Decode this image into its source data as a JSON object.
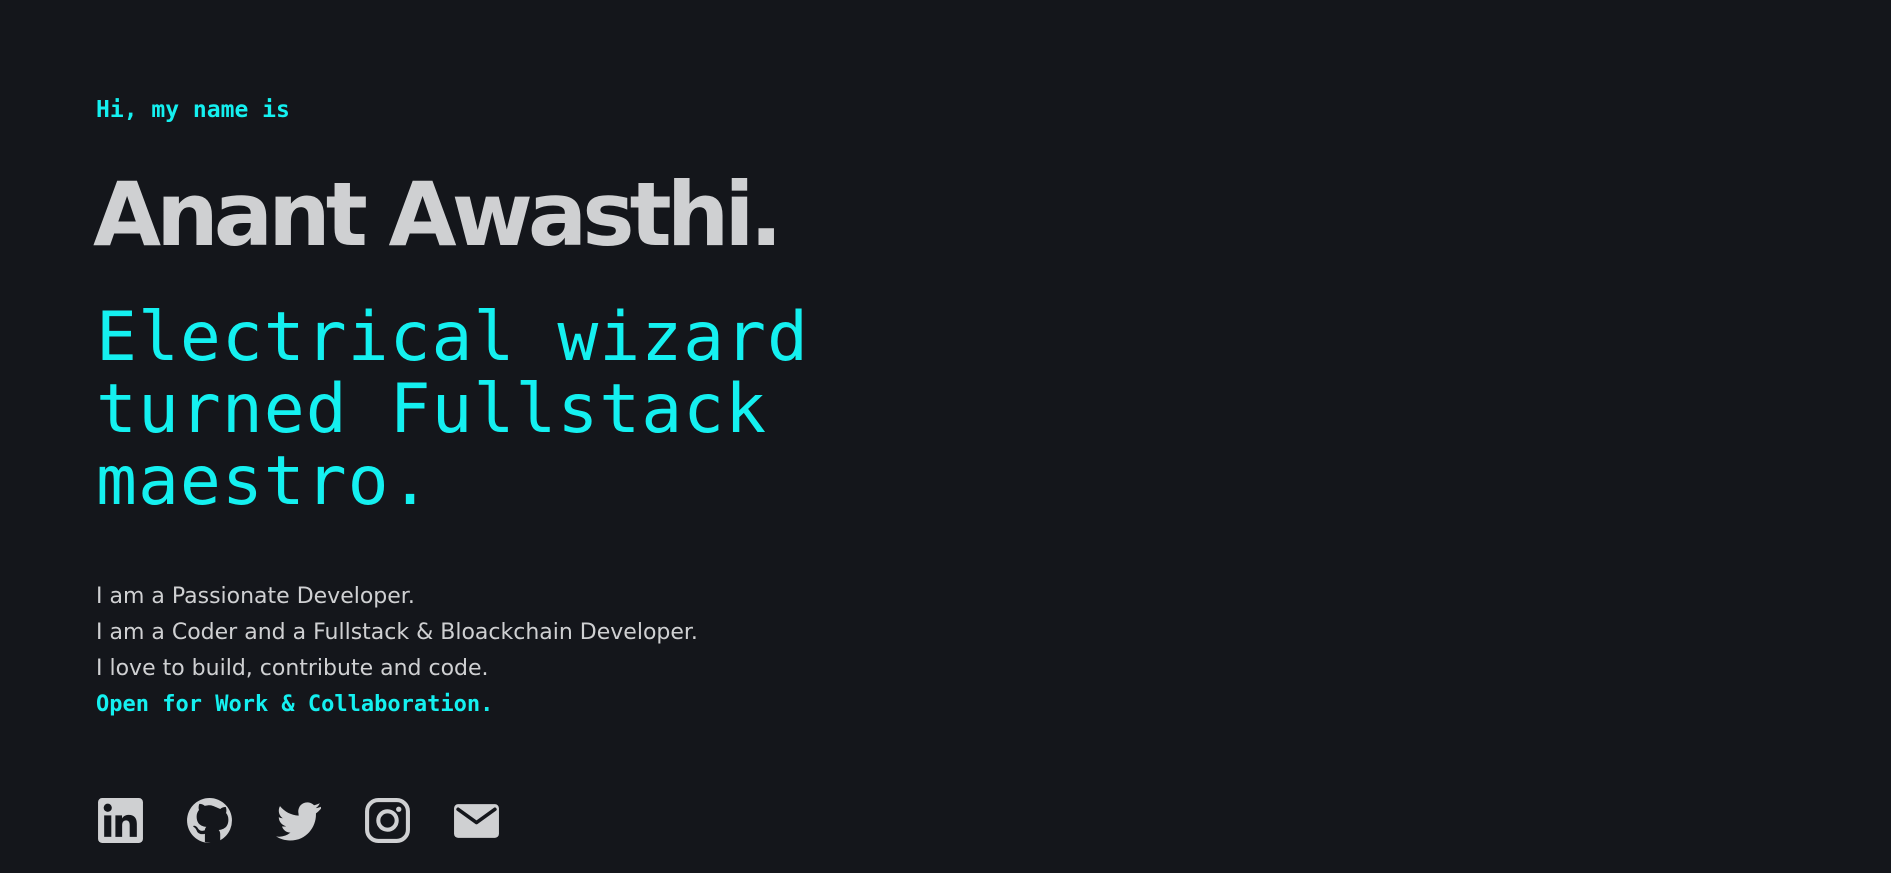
{
  "hero": {
    "greeting": "Hi, my name is",
    "name": "Anant Awasthi.",
    "tagline_lines": [
      "Electrical wizard",
      "turned Fullstack",
      "maestro."
    ],
    "bio_lines": [
      "I am a Passionate Developer.",
      "I am a Coder and a Fullstack & Bloackchain Developer.",
      "I love to build, contribute and code."
    ],
    "cta": "Open for Work & Collaboration."
  },
  "socials": [
    {
      "icon": "linkedin-icon"
    },
    {
      "icon": "github-icon"
    },
    {
      "icon": "twitter-icon"
    },
    {
      "icon": "instagram-icon"
    },
    {
      "icon": "mail-icon"
    }
  ],
  "colors": {
    "background": "#14161b",
    "accent": "#14f0f0",
    "text": "#cfd0d2"
  }
}
